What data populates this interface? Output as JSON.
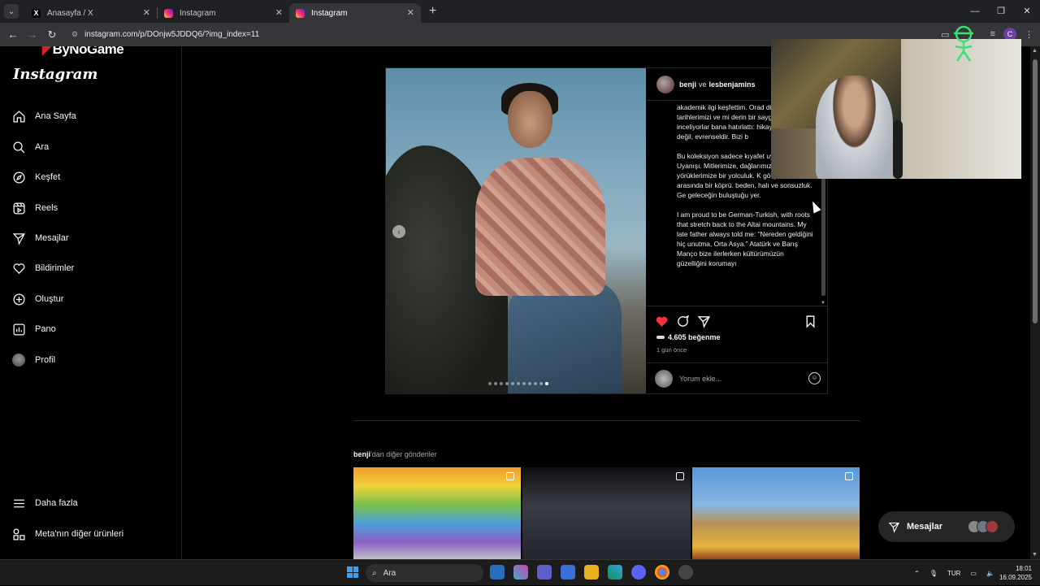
{
  "browser": {
    "tabs": [
      {
        "title": "Anasayfa / X",
        "icon": "x-logo-icon",
        "active": false
      },
      {
        "title": "Instagram",
        "icon": "instagram-icon",
        "active": false
      },
      {
        "title": "Instagram",
        "icon": "instagram-icon",
        "active": true
      }
    ],
    "url": "instagram.com/p/DOnjw5JDDQ6/?img_index=11",
    "profile_initial": "C"
  },
  "watermark": "ByNoGame",
  "sidebar": {
    "logo": "Instagram",
    "items": [
      {
        "label": "Ana Sayfa",
        "icon": "home-icon"
      },
      {
        "label": "Ara",
        "icon": "search-icon"
      },
      {
        "label": "Keşfet",
        "icon": "compass-icon"
      },
      {
        "label": "Reels",
        "icon": "reels-icon"
      },
      {
        "label": "Mesajlar",
        "icon": "send-icon"
      },
      {
        "label": "Bildirimler",
        "icon": "heart-icon"
      },
      {
        "label": "Oluştur",
        "icon": "plus-square-icon"
      },
      {
        "label": "Pano",
        "icon": "dashboard-icon"
      },
      {
        "label": "Profil",
        "icon": "profile-avatar"
      }
    ],
    "bottom": [
      {
        "label": "Daha fazla",
        "icon": "menu-icon"
      },
      {
        "label": "Meta'nın diğer ürünleri",
        "icon": "meta-products-icon"
      }
    ]
  },
  "post": {
    "author": "benji",
    "connector": "ve",
    "coauthor": "lesbenjamins",
    "caption_paragraphs": [
      "akademik ilgi keşfettim. Orad dillerimizi, tarihlerimizi ve mi derin bir saygıyla inceliyorlar bana hatırlattı: hikayelerimiz yerel değil, evrenseldir. Bizi b",
      "Bu koleksiyon sadece kıyafet uyanış. Altay Uyanışı. Mitlerimize, dağlarımıza, şam yörüklerimize bir yolculuk. K gökyüzü arasında bir köprü. beden, halı ve sonsuzluk. Ge geleceğin buluştuğu yer.",
      " I am proud to be German-Turkish, with roots that stretch back to the Altai mountains. My late father always told me: “Nereden geldiğini hiç unutma, Orta Asya.” Atatürk ve Barış Manço bize ilerlerken kültürümüzün güzelliğini korumayı"
    ],
    "likes": "4.605 beğenme",
    "time": "1 gün önce",
    "comment_placeholder": "Yorum ekle...",
    "carousel_count": 11,
    "carousel_current": 11
  },
  "more_posts": {
    "author": "benji",
    "suffix": "'dan diğer gönderiler"
  },
  "messages_pill": {
    "label": "Mesajlar"
  },
  "taskbar": {
    "search": "Ara",
    "lang": "TUR",
    "time": "18:01",
    "date": "16.09.2025"
  },
  "colors": {
    "like_red": "#ff3040",
    "accent_blue": "#3aa0f3"
  }
}
